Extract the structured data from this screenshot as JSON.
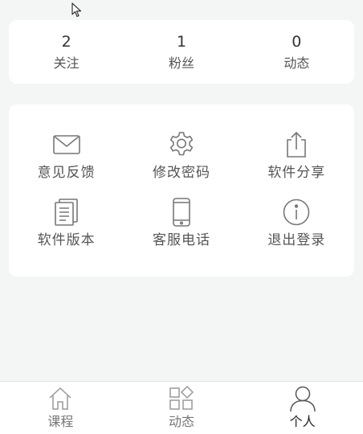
{
  "stats": [
    {
      "value": "2",
      "label": "关注"
    },
    {
      "value": "1",
      "label": "粉丝"
    },
    {
      "value": "0",
      "label": "动态"
    }
  ],
  "menu": [
    {
      "label": "意见反馈",
      "icon": "mail-icon"
    },
    {
      "label": "修改密码",
      "icon": "gear-icon"
    },
    {
      "label": "软件分享",
      "icon": "share-icon"
    },
    {
      "label": "软件版本",
      "icon": "document-icon"
    },
    {
      "label": "客服电话",
      "icon": "phone-icon"
    },
    {
      "label": "退出登录",
      "icon": "info-icon"
    }
  ],
  "tabs": [
    {
      "label": "课程",
      "icon": "home-icon",
      "active": false
    },
    {
      "label": "动态",
      "icon": "apps-icon",
      "active": false
    },
    {
      "label": "个人",
      "icon": "person-icon",
      "active": true
    }
  ]
}
